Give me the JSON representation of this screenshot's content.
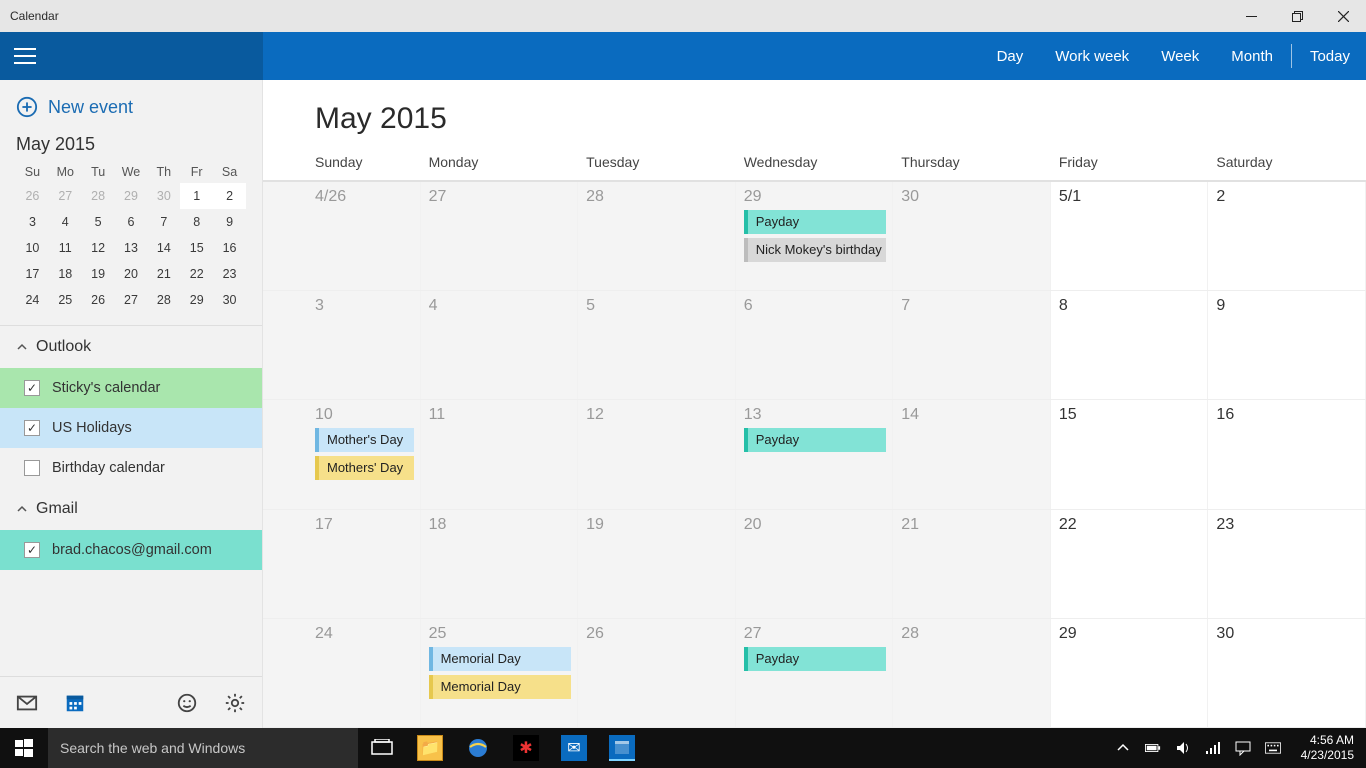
{
  "window": {
    "title": "Calendar"
  },
  "header": {
    "views": {
      "day": "Day",
      "workweek": "Work week",
      "week": "Week",
      "month": "Month",
      "today": "Today"
    }
  },
  "sidebar": {
    "new_event": "New event",
    "mini": {
      "title": "May 2015",
      "weekday_short": [
        "Su",
        "Mo",
        "Tu",
        "We",
        "Th",
        "Fr",
        "Sa"
      ],
      "days": [
        {
          "n": "26",
          "dim": true
        },
        {
          "n": "27",
          "dim": true
        },
        {
          "n": "28",
          "dim": true
        },
        {
          "n": "29",
          "dim": true
        },
        {
          "n": "30",
          "dim": true
        },
        {
          "n": "1",
          "hl": true
        },
        {
          "n": "2",
          "hl": true
        },
        {
          "n": "3"
        },
        {
          "n": "4"
        },
        {
          "n": "5"
        },
        {
          "n": "6"
        },
        {
          "n": "7"
        },
        {
          "n": "8"
        },
        {
          "n": "9"
        },
        {
          "n": "10"
        },
        {
          "n": "11"
        },
        {
          "n": "12"
        },
        {
          "n": "13"
        },
        {
          "n": "14"
        },
        {
          "n": "15"
        },
        {
          "n": "16"
        },
        {
          "n": "17"
        },
        {
          "n": "18"
        },
        {
          "n": "19"
        },
        {
          "n": "20"
        },
        {
          "n": "21"
        },
        {
          "n": "22"
        },
        {
          "n": "23"
        },
        {
          "n": "24"
        },
        {
          "n": "25"
        },
        {
          "n": "26"
        },
        {
          "n": "27"
        },
        {
          "n": "28"
        },
        {
          "n": "29"
        },
        {
          "n": "30"
        }
      ]
    },
    "sections": [
      {
        "name": "Outlook",
        "items": [
          {
            "label": "Sticky's calendar",
            "checked": true,
            "cls": "bg-green"
          },
          {
            "label": "US Holidays",
            "checked": true,
            "cls": "bg-blue"
          },
          {
            "label": "Birthday calendar",
            "checked": false,
            "cls": ""
          }
        ]
      },
      {
        "name": "Gmail",
        "items": [
          {
            "label": "brad.chacos@gmail.com",
            "checked": true,
            "cls": "bg-teal"
          }
        ]
      }
    ]
  },
  "month": {
    "title": "May 2015",
    "weekday_labels": [
      "Sunday",
      "Monday",
      "Tuesday",
      "Wednesday",
      "Thursday",
      "Friday",
      "Saturday"
    ],
    "weeks": [
      [
        {
          "num": "4/26",
          "dim": true
        },
        {
          "num": "27",
          "dim": true
        },
        {
          "num": "28",
          "dim": true
        },
        {
          "num": "29",
          "dim": true,
          "events": [
            {
              "t": "Payday",
              "c": "teal"
            },
            {
              "t": "Nick Mokey's birthday",
              "c": "gray"
            }
          ]
        },
        {
          "num": "30",
          "dim": true
        },
        {
          "num": "5/1"
        },
        {
          "num": "2"
        }
      ],
      [
        {
          "num": "3",
          "dim": true
        },
        {
          "num": "4",
          "dim": true
        },
        {
          "num": "5",
          "dim": true
        },
        {
          "num": "6",
          "dim": true
        },
        {
          "num": "7",
          "dim": true
        },
        {
          "num": "8"
        },
        {
          "num": "9"
        }
      ],
      [
        {
          "num": "10",
          "dim": true,
          "events": [
            {
              "t": "Mother's Day",
              "c": "blue"
            },
            {
              "t": "Mothers' Day",
              "c": "yellow"
            }
          ]
        },
        {
          "num": "11",
          "dim": true
        },
        {
          "num": "12",
          "dim": true
        },
        {
          "num": "13",
          "dim": true,
          "events": [
            {
              "t": "Payday",
              "c": "teal"
            }
          ]
        },
        {
          "num": "14",
          "dim": true
        },
        {
          "num": "15"
        },
        {
          "num": "16"
        }
      ],
      [
        {
          "num": "17",
          "dim": true
        },
        {
          "num": "18",
          "dim": true
        },
        {
          "num": "19",
          "dim": true
        },
        {
          "num": "20",
          "dim": true
        },
        {
          "num": "21",
          "dim": true
        },
        {
          "num": "22"
        },
        {
          "num": "23"
        }
      ],
      [
        {
          "num": "24",
          "dim": true
        },
        {
          "num": "25",
          "dim": true,
          "events": [
            {
              "t": "Memorial Day",
              "c": "blue"
            },
            {
              "t": "Memorial Day",
              "c": "yellow"
            }
          ]
        },
        {
          "num": "26",
          "dim": true
        },
        {
          "num": "27",
          "dim": true,
          "events": [
            {
              "t": "Payday",
              "c": "teal"
            }
          ]
        },
        {
          "num": "28",
          "dim": true
        },
        {
          "num": "29"
        },
        {
          "num": "30"
        }
      ]
    ]
  },
  "taskbar": {
    "search_placeholder": "Search the web and Windows",
    "time": "4:56 AM",
    "date": "4/23/2015"
  }
}
